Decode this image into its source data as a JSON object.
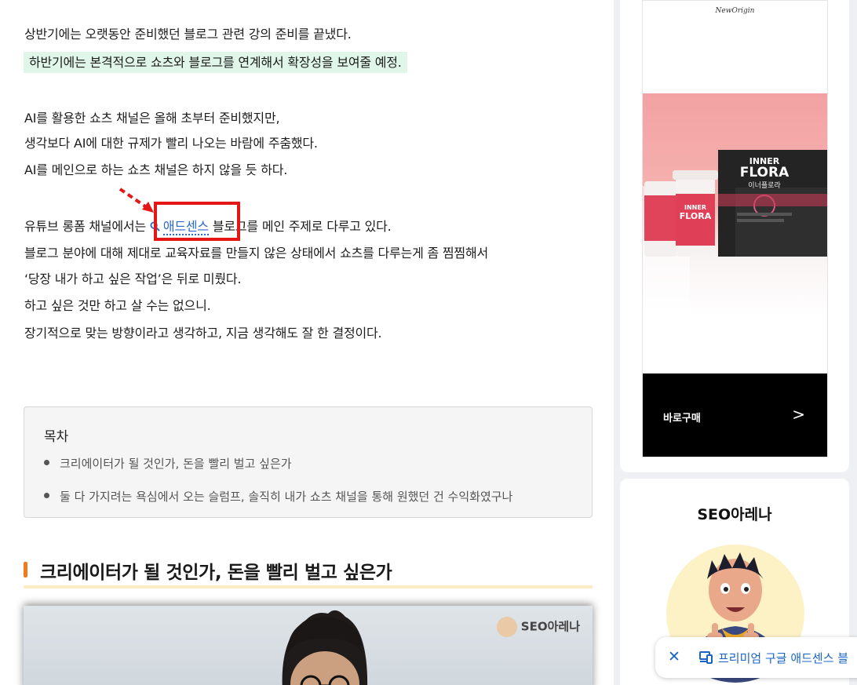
{
  "post": {
    "p1": "상반기에는 오랫동안 준비했던 블로그 관련 강의 준비를 끝냈다.",
    "p2": "하반기에는 본격적으로 쇼츠와 블로그를 연계해서 확장성을 보여줄 예정.",
    "p3": "AI를 활용한 쇼츠 채널은 올해 초부터 준비했지만,",
    "p4": "생각보다 AI에 대한 규제가 빨리 나오는 바람에 주춤했다.",
    "p5": "AI를 메인으로 하는 쇼츠 채널은 하지 않을 듯 하다.",
    "p6_before": "유튜브 롱폼 채널에서는",
    "keyword_link": "애드센스",
    "p6_after": "블로그를 메인 주제로 다루고 있다.",
    "p7": "블로그 분야에 대해 제대로 교육자료를 만들지 않은 상태에서 쇼츠를 다루는게 좀 찜찜해서",
    "p8": "‘당장 내가 하고 싶은 작업’은 뒤로 미뤘다.",
    "p9": "하고 싶은 것만 하고 살 수는 없으니.",
    "p10": "장기적으로 맞는 방향이라고 생각하고, 지금 생각해도 잘 한 결정이다."
  },
  "toc": {
    "title": "목차",
    "items": [
      "크리에이터가 될 것인가, 돈을 빨리 벌고 싶은가",
      "둘 다 가지려는 욕심에서 오는 슬럼프, 솔직히 내가 쇼츠 채널을 통해 원했던 건 수익화였구나"
    ]
  },
  "heading": "크리에이터가 될 것인가, 돈을 빨리 벌고 싶은가",
  "image_watermark": "SEO아레나",
  "sidebar": {
    "ad": {
      "brand": "NewOrigin",
      "product_en_1": "INNER",
      "product_en_2": "FLORA",
      "product_kr": "이너플로라",
      "buy_label": "바로구매",
      "buy_arrow": ">"
    },
    "profile_title": "SEO아레나"
  },
  "banner": {
    "close": "✕",
    "text": "프리미엄 구글 애드센스 블"
  },
  "colors": {
    "highlight": "#dff6e8",
    "link": "#2b6acb",
    "annotation_red": "#e51616",
    "heading_accent": "#f27a1a"
  }
}
